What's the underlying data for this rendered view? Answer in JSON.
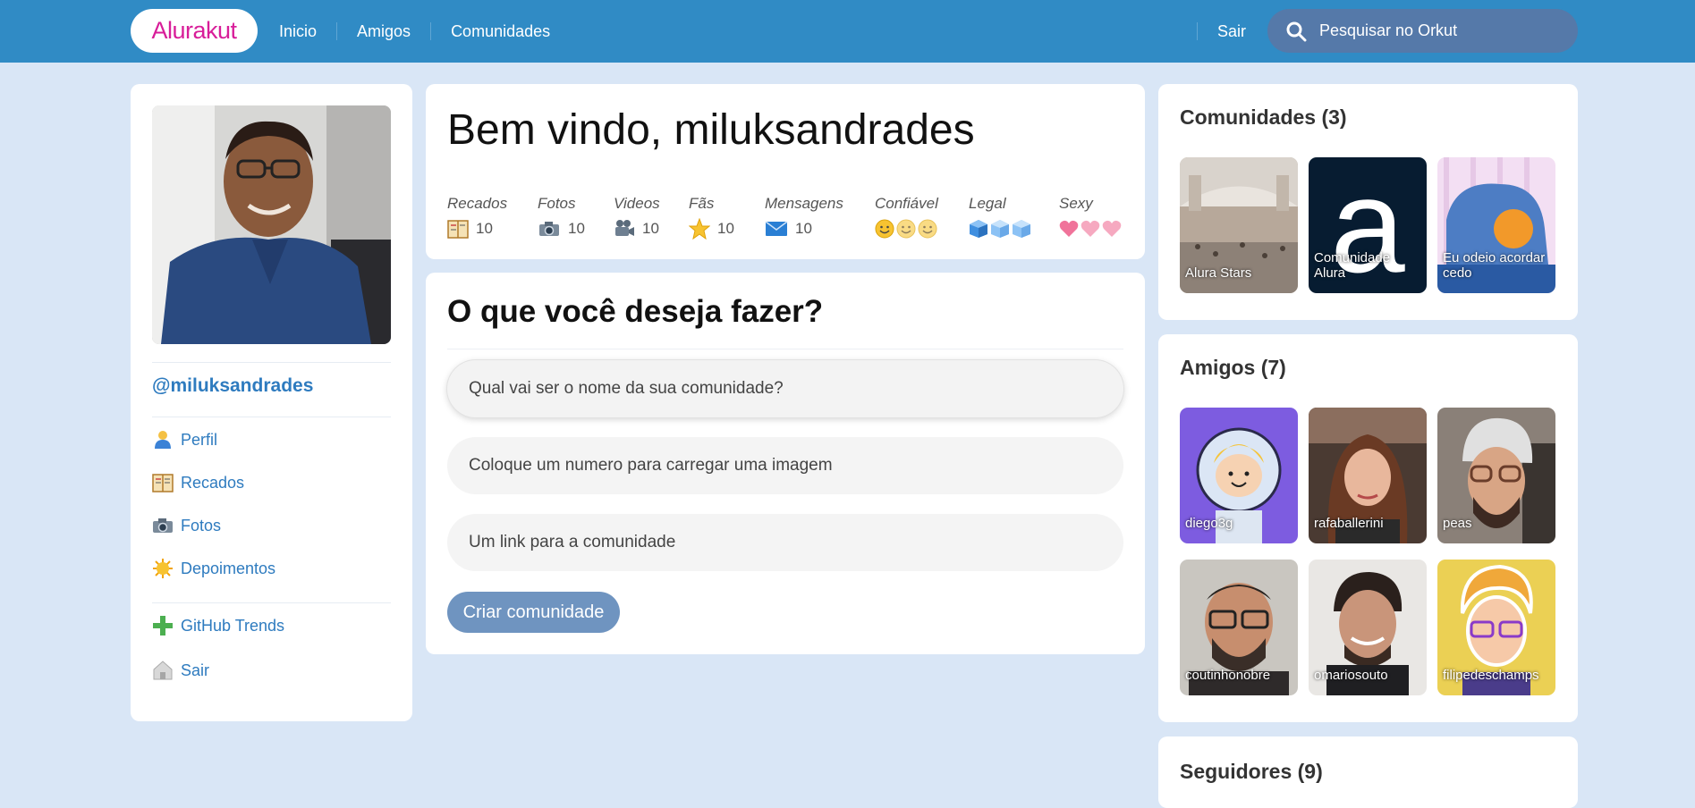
{
  "header": {
    "logo": "Alurakut",
    "nav": [
      "Inicio",
      "Amigos",
      "Comunidades"
    ],
    "logout": "Sair",
    "search_placeholder": "Pesquisar no Orkut"
  },
  "profile": {
    "username": "@miluksandrades",
    "menu": [
      {
        "label": "Perfil",
        "icon": "user-icon"
      },
      {
        "label": "Recados",
        "icon": "book-icon"
      },
      {
        "label": "Fotos",
        "icon": "camera-icon"
      },
      {
        "label": "Depoimentos",
        "icon": "sun-icon"
      }
    ],
    "menu2": [
      {
        "label": "GitHub Trends",
        "icon": "plus-icon"
      },
      {
        "label": "Sair",
        "icon": "logout-icon"
      }
    ]
  },
  "welcome": {
    "title": "Bem vindo, miluksandrades",
    "stats": [
      {
        "label": "Recados",
        "value": "10",
        "icon": "book-icon"
      },
      {
        "label": "Fotos",
        "value": "10",
        "icon": "camera-icon"
      },
      {
        "label": "Videos",
        "value": "10",
        "icon": "video-camera-icon"
      },
      {
        "label": "Fãs",
        "value": "10",
        "icon": "star-icon"
      },
      {
        "label": "Mensagens",
        "value": "10",
        "icon": "envelope-icon"
      },
      {
        "label": "Confiável",
        "icon": "smiley-icon",
        "rating": 3
      },
      {
        "label": "Legal",
        "icon": "ice-cube-icon",
        "rating": 3
      },
      {
        "label": "Sexy",
        "icon": "heart-icon",
        "rating": 3
      }
    ]
  },
  "form": {
    "title": "O que você deseja fazer?",
    "fields": [
      "Qual vai ser o nome da sua comunidade?",
      "Coloque um numero para carregar uma imagem",
      "Um link para a comunidade"
    ],
    "submit": "Criar comunidade"
  },
  "communities": {
    "title": "Comunidades (3)",
    "items": [
      "Alura Stars",
      "Comunidade Alura",
      "Eu odeio acordar cedo"
    ]
  },
  "friends": {
    "title": "Amigos (7)",
    "items": [
      "diego3g",
      "rafaballerini",
      "peas",
      "coutinhonobre",
      "omariosouto",
      "filipedeschamps"
    ]
  },
  "followers": {
    "title": "Seguidores (9)"
  },
  "colors": {
    "topbar": "#308bc5",
    "background": "#d9e6f6",
    "link": "#2e7bbf",
    "logo": "#d81d99",
    "button": "#6f94c0"
  }
}
